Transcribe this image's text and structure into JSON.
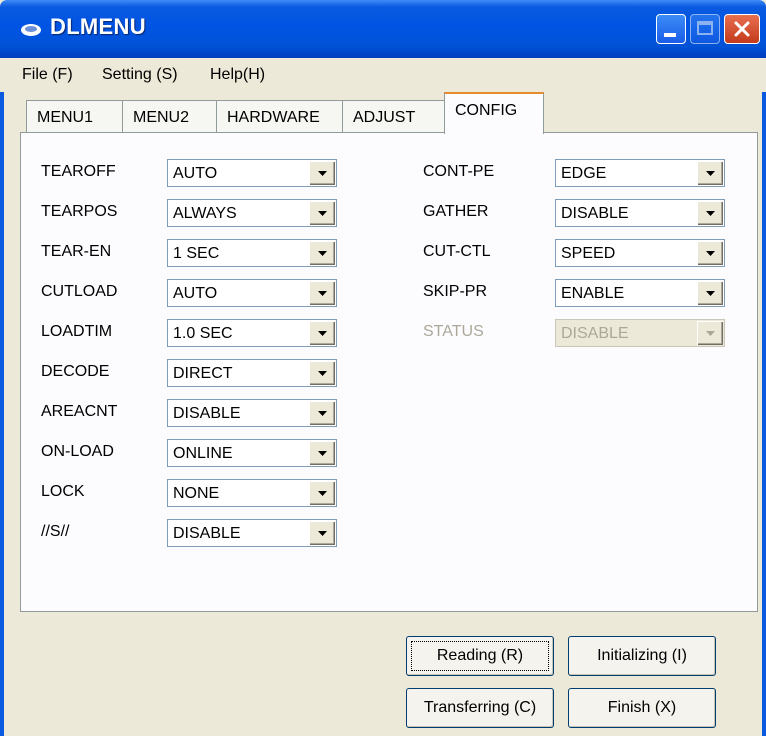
{
  "window": {
    "title": "DLMENU"
  },
  "menubar": {
    "items": [
      "File (F)",
      "Setting (S)",
      "Help(H)"
    ]
  },
  "tabs": [
    "MENU1",
    "MENU2",
    "HARDWARE",
    "ADJUST",
    "CONFIG"
  ],
  "active_tab": "CONFIG",
  "left_settings": [
    {
      "label": "TEAROFF",
      "value": "AUTO"
    },
    {
      "label": "TEARPOS",
      "value": "ALWAYS"
    },
    {
      "label": "TEAR-EN",
      "value": "1 SEC"
    },
    {
      "label": "CUTLOAD",
      "value": "AUTO"
    },
    {
      "label": "LOADTIM",
      "value": "1.0 SEC"
    },
    {
      "label": "DECODE",
      "value": "DIRECT"
    },
    {
      "label": "AREACNT",
      "value": "DISABLE"
    },
    {
      "label": "ON-LOAD",
      "value": "ONLINE"
    },
    {
      "label": "LOCK",
      "value": "NONE"
    },
    {
      "label": "//S//",
      "value": "DISABLE"
    }
  ],
  "right_settings": [
    {
      "label": "CONT-PE",
      "value": "EDGE"
    },
    {
      "label": "GATHER",
      "value": "DISABLE"
    },
    {
      "label": "CUT-CTL",
      "value": "SPEED"
    },
    {
      "label": "SKIP-PR",
      "value": "ENABLE"
    },
    {
      "label": "STATUS",
      "value": "DISABLE",
      "disabled": true
    }
  ],
  "buttons": {
    "reading": "Reading (R)",
    "initializing": "Initializing (I)",
    "transferring": "Transferring (C)",
    "finish": "Finish (X)"
  },
  "colors": {
    "titlebar": "#0054e3",
    "active_tab_accent": "#e68b2c",
    "close_button": "#c33b1c"
  }
}
